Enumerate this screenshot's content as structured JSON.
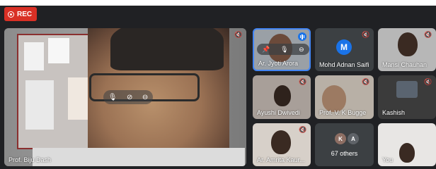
{
  "recording": {
    "label": "REC",
    "color": "#d93025"
  },
  "main_tile": {
    "name": "Prof. Biju Dash"
  },
  "tiles": [
    {
      "name": "Ar. Jyoti Arora",
      "speaking": true
    },
    {
      "name": "Mohd Adnan Saifi",
      "avatar_letter": "M"
    },
    {
      "name": "Mansi Chauhan"
    },
    {
      "name": "Ayushi Dwivedi"
    },
    {
      "name": "Prof. V. K Bugge"
    },
    {
      "name": "Kashish"
    },
    {
      "name": "Ar. Amrita Kaur..."
    },
    {
      "others_count": "67 others",
      "avatar_letters": [
        "K",
        "A"
      ]
    },
    {
      "name": "You"
    }
  ],
  "icons": {
    "mute": "mic-off-icon",
    "pin": "pin-icon",
    "mic": "mic-icon",
    "remove": "remove-icon"
  },
  "colors": {
    "accent": "#4285f4",
    "avatar_blue": "#1a73e8",
    "dark_bg": "#202124"
  }
}
